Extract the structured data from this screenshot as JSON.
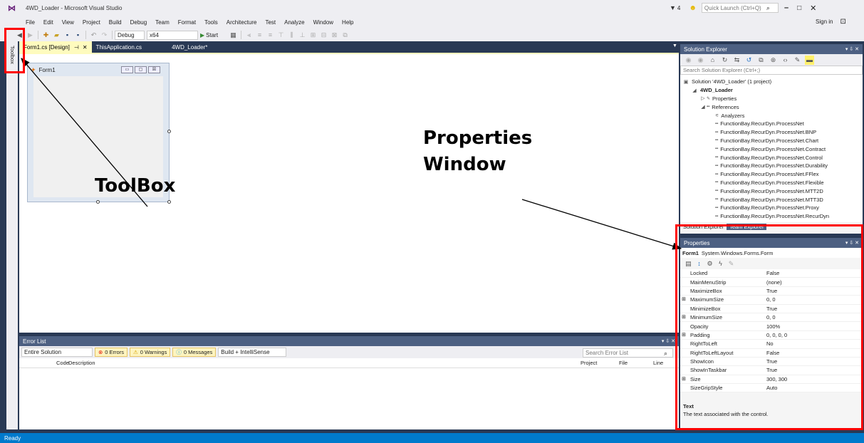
{
  "window": {
    "title": "4WD_Loader - Microsoft Visual Studio",
    "sign_in": "Sign in",
    "notification_count": "4",
    "quick_launch_placeholder": "Quick Launch (Ctrl+Q)"
  },
  "menu": [
    "File",
    "Edit",
    "View",
    "Project",
    "Build",
    "Debug",
    "Team",
    "Format",
    "Tools",
    "Architecture",
    "Test",
    "Analyze",
    "Window",
    "Help"
  ],
  "toolbar": {
    "config": "Debug",
    "platform": "x64",
    "start": "Start"
  },
  "left_strip": {
    "label": "Toolbox"
  },
  "doc_tabs": [
    {
      "label": "Form1.cs [Design]",
      "active": true
    },
    {
      "label": "ThisApplication.cs",
      "active": false
    },
    {
      "label": "4WD_Loader*",
      "active": false
    }
  ],
  "designer": {
    "form_title": "Form1"
  },
  "error_list": {
    "title": "Error List",
    "scope": "Entire Solution",
    "errors": "0 Errors",
    "warnings": "0 Warnings",
    "messages": "0 Messages",
    "build_filter": "Build + IntelliSense",
    "search_placeholder": "Search Error List",
    "columns": [
      "Code",
      "Description",
      "Project",
      "File",
      "Line"
    ]
  },
  "solution_explorer": {
    "title": "Solution Explorer",
    "search_placeholder": "Search Solution Explorer (Ctrl+;)",
    "tree": [
      {
        "label": "Solution '4WD_Loader' (1 project)",
        "depth": 0,
        "glyph": "▣",
        "bold": false
      },
      {
        "label": "4WD_Loader",
        "depth": 1,
        "glyph": "◢",
        "bold": true
      },
      {
        "label": "Properties",
        "depth": 2,
        "glyph": "▷",
        "bold": false
      },
      {
        "label": "References",
        "depth": 2,
        "glyph": "◢",
        "bold": false
      },
      {
        "label": "Analyzers",
        "depth": 3,
        "glyph": "",
        "bold": false
      },
      {
        "label": "FunctionBay.RecurDyn.ProcessNet",
        "depth": 3,
        "glyph": "",
        "bold": false
      },
      {
        "label": "FunctionBay.RecurDyn.ProcessNet.BNP",
        "depth": 3,
        "glyph": "",
        "bold": false
      },
      {
        "label": "FunctionBay.RecurDyn.ProcessNet.Chart",
        "depth": 3,
        "glyph": "",
        "bold": false
      },
      {
        "label": "FunctionBay.RecurDyn.ProcessNet.Contract",
        "depth": 3,
        "glyph": "",
        "bold": false
      },
      {
        "label": "FunctionBay.RecurDyn.ProcessNet.Control",
        "depth": 3,
        "glyph": "",
        "bold": false
      },
      {
        "label": "FunctionBay.RecurDyn.ProcessNet.Durability",
        "depth": 3,
        "glyph": "",
        "bold": false
      },
      {
        "label": "FunctionBay.RecurDyn.ProcessNet.FFlex",
        "depth": 3,
        "glyph": "",
        "bold": false
      },
      {
        "label": "FunctionBay.RecurDyn.ProcessNet.Flexible",
        "depth": 3,
        "glyph": "",
        "bold": false
      },
      {
        "label": "FunctionBay.RecurDyn.ProcessNet.MTT2D",
        "depth": 3,
        "glyph": "",
        "bold": false
      },
      {
        "label": "FunctionBay.RecurDyn.ProcessNet.MTT3D",
        "depth": 3,
        "glyph": "",
        "bold": false
      },
      {
        "label": "FunctionBay.RecurDyn.ProcessNet.Proxy",
        "depth": 3,
        "glyph": "",
        "bold": false
      },
      {
        "label": "FunctionBay.RecurDyn.ProcessNet.RecurDyn",
        "depth": 3,
        "glyph": "",
        "bold": false
      }
    ],
    "tabs": [
      "Solution Explorer",
      "Team Explorer"
    ]
  },
  "properties": {
    "title": "Properties",
    "object_name": "Form1",
    "object_type": "System.Windows.Forms.Form",
    "rows": [
      {
        "name": "Locked",
        "value": "False",
        "expandable": false
      },
      {
        "name": "MainMenuStrip",
        "value": "(none)",
        "expandable": false
      },
      {
        "name": "MaximizeBox",
        "value": "True",
        "expandable": false
      },
      {
        "name": "MaximumSize",
        "value": "0, 0",
        "expandable": true
      },
      {
        "name": "MinimizeBox",
        "value": "True",
        "expandable": false
      },
      {
        "name": "MinimumSize",
        "value": "0, 0",
        "expandable": true
      },
      {
        "name": "Opacity",
        "value": "100%",
        "expandable": false
      },
      {
        "name": "Padding",
        "value": "0, 0, 0, 0",
        "expandable": true
      },
      {
        "name": "RightToLeft",
        "value": "No",
        "expandable": false
      },
      {
        "name": "RightToLeftLayout",
        "value": "False",
        "expandable": false
      },
      {
        "name": "ShowIcon",
        "value": "True",
        "expandable": false
      },
      {
        "name": "ShowInTaskbar",
        "value": "True",
        "expandable": false
      },
      {
        "name": "Size",
        "value": "300, 300",
        "expandable": true
      },
      {
        "name": "SizeGripStyle",
        "value": "Auto",
        "expandable": false
      }
    ],
    "desc_title": "Text",
    "desc_text": "The text associated with the control."
  },
  "status_bar": {
    "text": "Ready"
  },
  "annotations": {
    "toolbox": "ToolBox",
    "properties_line1": "Properties",
    "properties_line2": "Window"
  },
  "colors": {
    "vs_dark": "#293955",
    "status_blue": "#007acc",
    "annotation_red": "#ff0000",
    "panel_header": "#4d6082"
  }
}
